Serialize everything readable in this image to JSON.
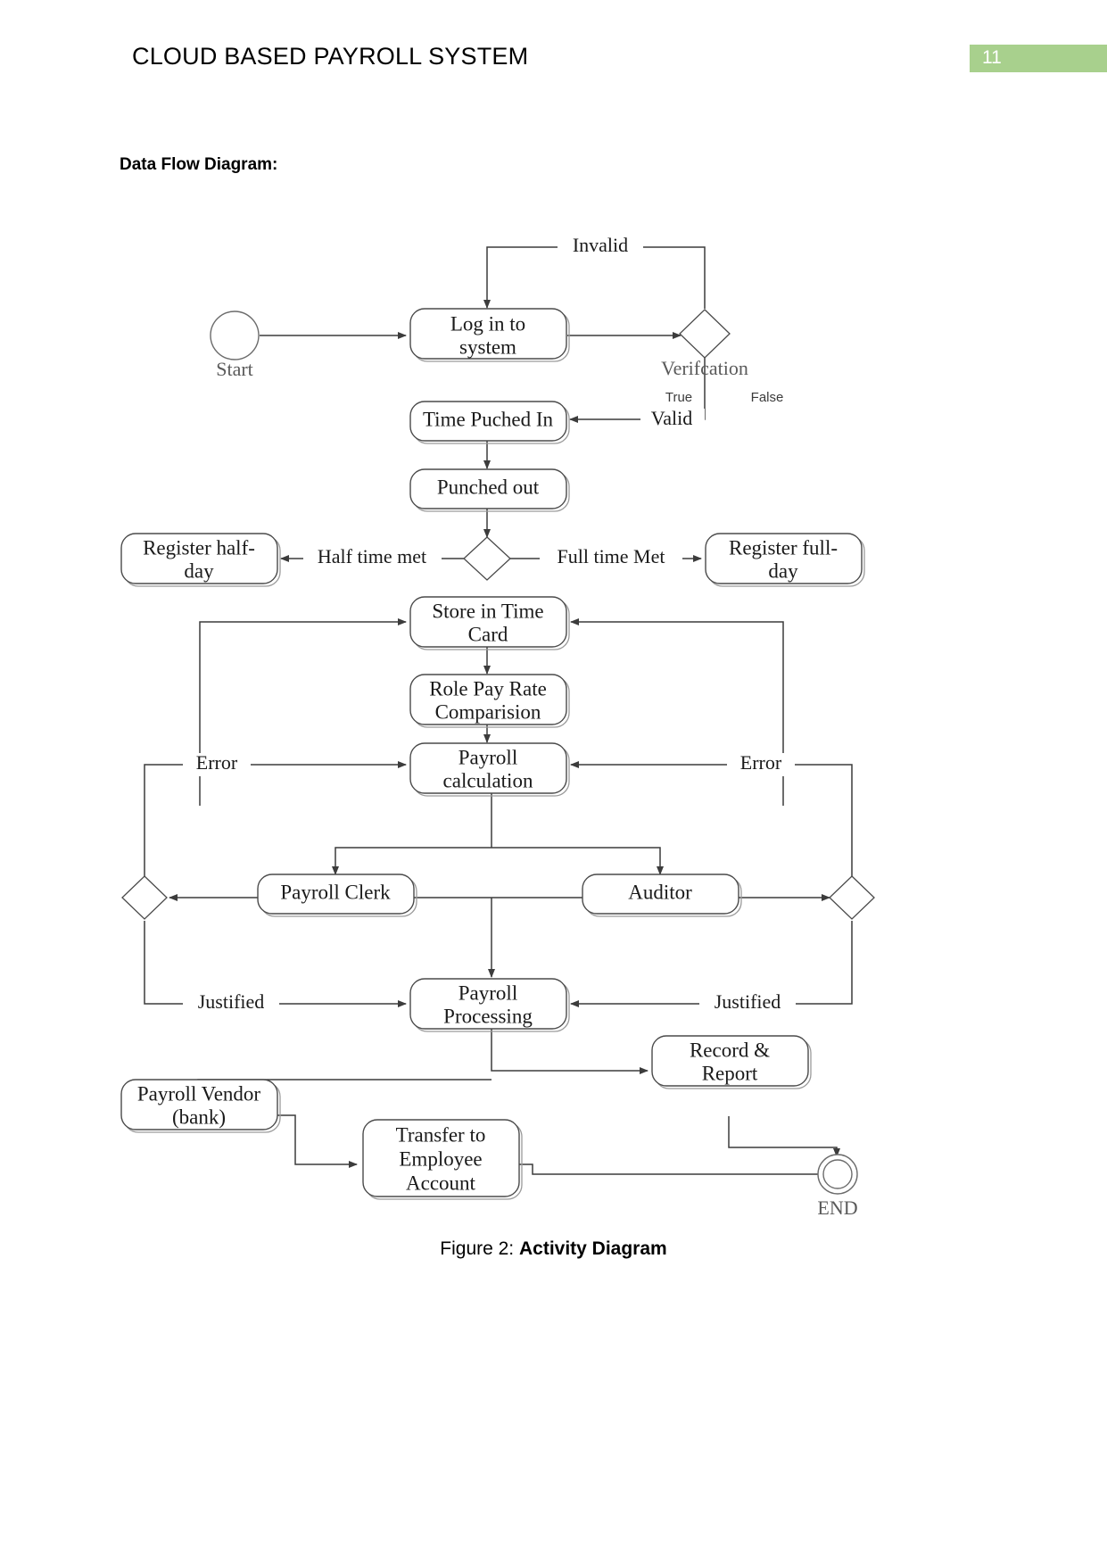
{
  "header": {
    "document_title": "CLOUD BASED PAYROLL SYSTEM",
    "page_number": "11",
    "badge_color": "#a8d08d"
  },
  "section": {
    "label": "Data Flow Diagram:"
  },
  "figure": {
    "caption_prefix": "Figure 2: ",
    "caption_title": "Activity Diagram"
  },
  "diagram": {
    "type": "activity-diagram",
    "nodes": {
      "start": "Start",
      "login": "Log in to system",
      "login_line1": "Log in to",
      "login_line2": "system",
      "verification": "Verifcation",
      "time_punched_in": "Time Puched In",
      "punched_out": "Punched out",
      "register_half_day_line1": "Register half-",
      "register_half_day_line2": "day",
      "register_full_day_line1": "Register full-",
      "register_full_day_line2": "day",
      "store_time_card_line1": "Store in Time",
      "store_time_card_line2": "Card",
      "role_pay_rate_line1": "Role Pay Rate",
      "role_pay_rate_line2": "Comparision",
      "payroll_calculation_line1": "Payroll",
      "payroll_calculation_line2": "calculation",
      "payroll_clerk": "Payroll Clerk",
      "auditor": "Auditor",
      "payroll_processing_line1": "Payroll",
      "payroll_processing_line2": "Processing",
      "record_report_line1": "Record &",
      "record_report_line2": "Report",
      "payroll_vendor_line1": "Payroll Vendor",
      "payroll_vendor_line2": "(bank)",
      "transfer_line1": "Transfer to",
      "transfer_line2": "Employee",
      "transfer_line3": "Account",
      "end": "END"
    },
    "edge_labels": {
      "invalid": "Invalid",
      "valid": "Valid",
      "true": "True",
      "false": "False",
      "half_time_met": "Half time met",
      "full_time_met": "Full time Met",
      "error_left": "Error",
      "error_right": "Error",
      "justified_left": "Justified",
      "justified_right": "Justified"
    }
  }
}
